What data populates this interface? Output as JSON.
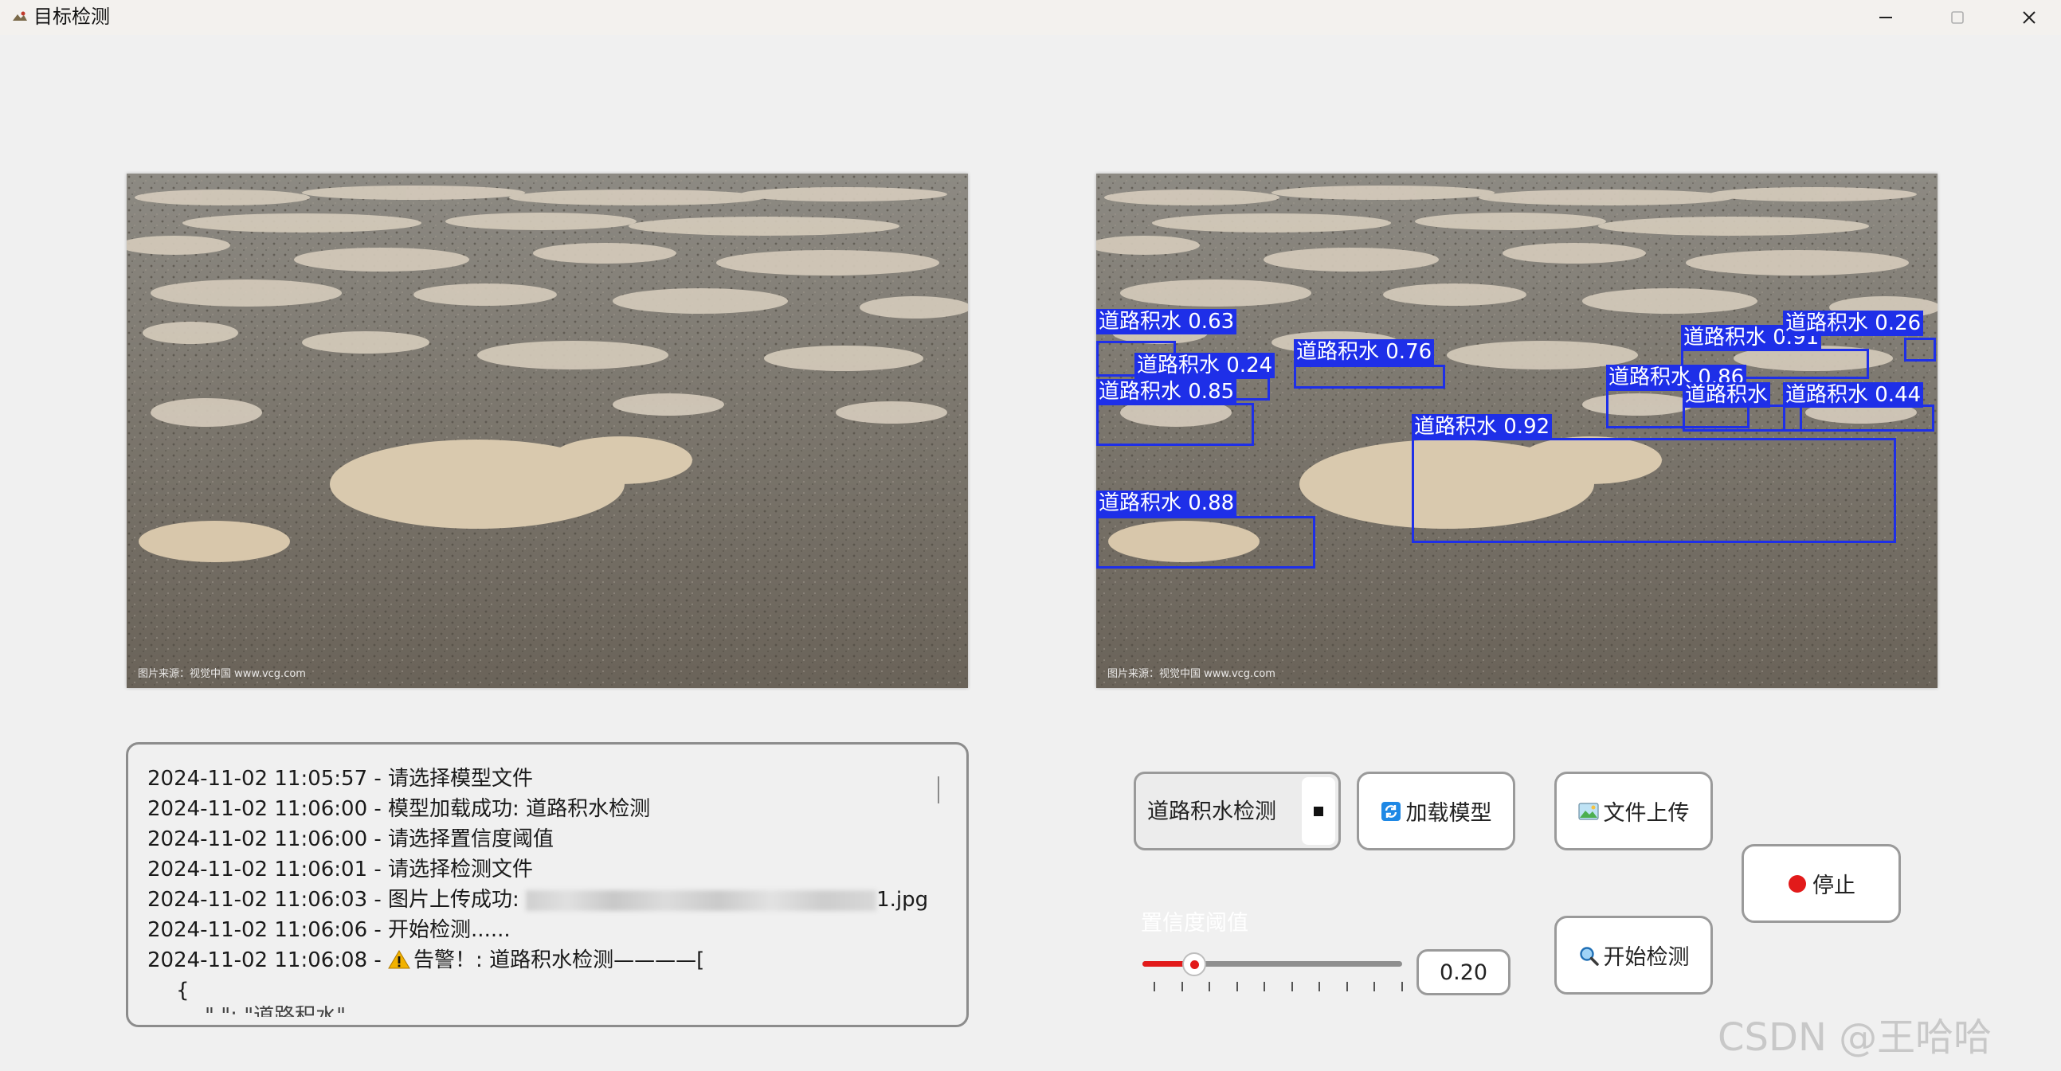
{
  "window": {
    "title": "目标检测"
  },
  "images": {
    "watermark": "图片来源：视觉中国 www.vcg.com"
  },
  "detections": [
    {
      "label": "道路积水 0.63"
    },
    {
      "label": "道路积水 0.24"
    },
    {
      "label": "道路积水 0.76"
    },
    {
      "label": "道路积水 0.85"
    },
    {
      "label": "道路积水 0.88"
    },
    {
      "label": "道路积水 0.92"
    },
    {
      "label": "道路积水 0.91"
    },
    {
      "label": "道路积水 0.26"
    },
    {
      "label": "道路积水 0.86"
    },
    {
      "label": "道路积水 0.44"
    },
    {
      "label": "道路积水"
    }
  ],
  "log": {
    "lines": [
      "2024-11-02 11:05:57 - 请选择模型文件",
      "2024-11-02 11:06:00 - 模型加载成功: 道路积水检测",
      "2024-11-02 11:06:00 - 请选择置信度阈值",
      "2024-11-02 11:06:01 - 请选择检测文件"
    ],
    "upload_prefix": "2024-11-02 11:06:03 - 图片上传成功: ",
    "upload_suffix": "1.jpg",
    "start_line": "2024-11-02 11:06:06 - 开始检测......",
    "alert_prefix": "2024-11-02 11:06:08 - ",
    "alert_text": "告警！: 道路积水检测————[",
    "brace": "{",
    "cutoff": "\"        \": \"道路积水\""
  },
  "controls": {
    "model_select_value": "道路积水检测",
    "load_model_label": "加载模型",
    "upload_label": "文件上传",
    "detect_label": "开始检测",
    "stop_label": "停止",
    "threshold_label": "置信度阈值",
    "threshold_value_text": "0.20",
    "threshold_value": 0.2
  },
  "watermark_text": "CSDN @王哈哈^_^",
  "colors": {
    "box": "#1e2fe8",
    "slider_fill": "#e21a1a",
    "stop_dot": "#e21a1a"
  }
}
